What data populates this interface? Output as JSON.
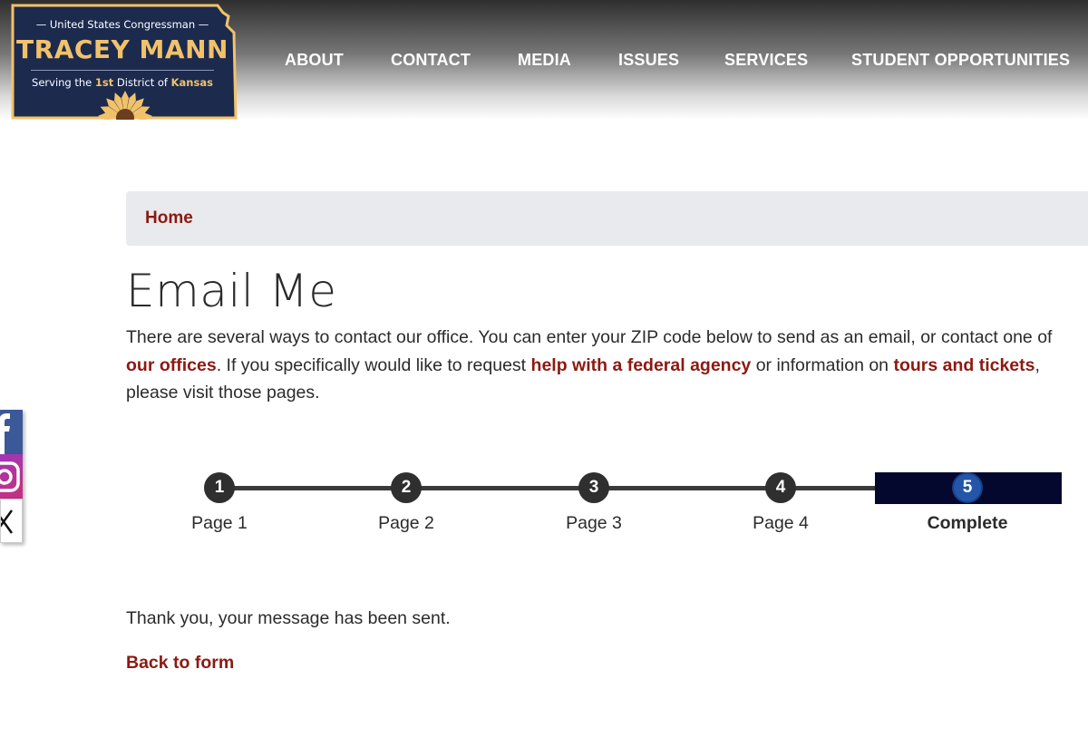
{
  "logo": {
    "line1": "— United States Congressman —",
    "name": "TRACEY MANN",
    "line3_prefix": "Serving the ",
    "line3_district": "1st",
    "line3_middle": " District of ",
    "line3_state": "Kansas",
    "colors": {
      "navy": "#1c2a4e",
      "gold": "#f1c26a"
    }
  },
  "nav": {
    "items": [
      {
        "label": "ABOUT"
      },
      {
        "label": "CONTACT"
      },
      {
        "label": "MEDIA"
      },
      {
        "label": "ISSUES"
      },
      {
        "label": "SERVICES"
      },
      {
        "label": "STUDENT OPPORTUNITIES"
      }
    ]
  },
  "breadcrumb": {
    "home": "Home"
  },
  "page": {
    "title": "Email Me",
    "intro_1": "There are several ways to contact our office. You can enter your ZIP code below to send as an email, or contact one of ",
    "link_offices": "our offices",
    "intro_2": ". If you specifically would like to request ",
    "link_agency": "help with a federal agency",
    "intro_3": " or information on ",
    "link_tours": "tours and tickets",
    "intro_4": ", please visit those pages."
  },
  "social": {
    "items": [
      {
        "icon": "facebook-icon",
        "color": "#3b5998"
      },
      {
        "icon": "instagram-icon",
        "color": "#c13584"
      },
      {
        "icon": "x-icon",
        "color": "#000000"
      }
    ]
  },
  "progress": {
    "steps": [
      {
        "number": "1",
        "label": "Page 1"
      },
      {
        "number": "2",
        "label": "Page 2"
      },
      {
        "number": "3",
        "label": "Page 3"
      },
      {
        "number": "4",
        "label": "Page 4"
      },
      {
        "number": "5",
        "label": "Complete"
      }
    ],
    "current_step": 5
  },
  "result": {
    "message": "Thank you, your message has been sent.",
    "back_link": "Back to form"
  },
  "colors": {
    "link": "#8b1a12",
    "complete_band": "#05082e",
    "active_step": "#2356a8"
  }
}
